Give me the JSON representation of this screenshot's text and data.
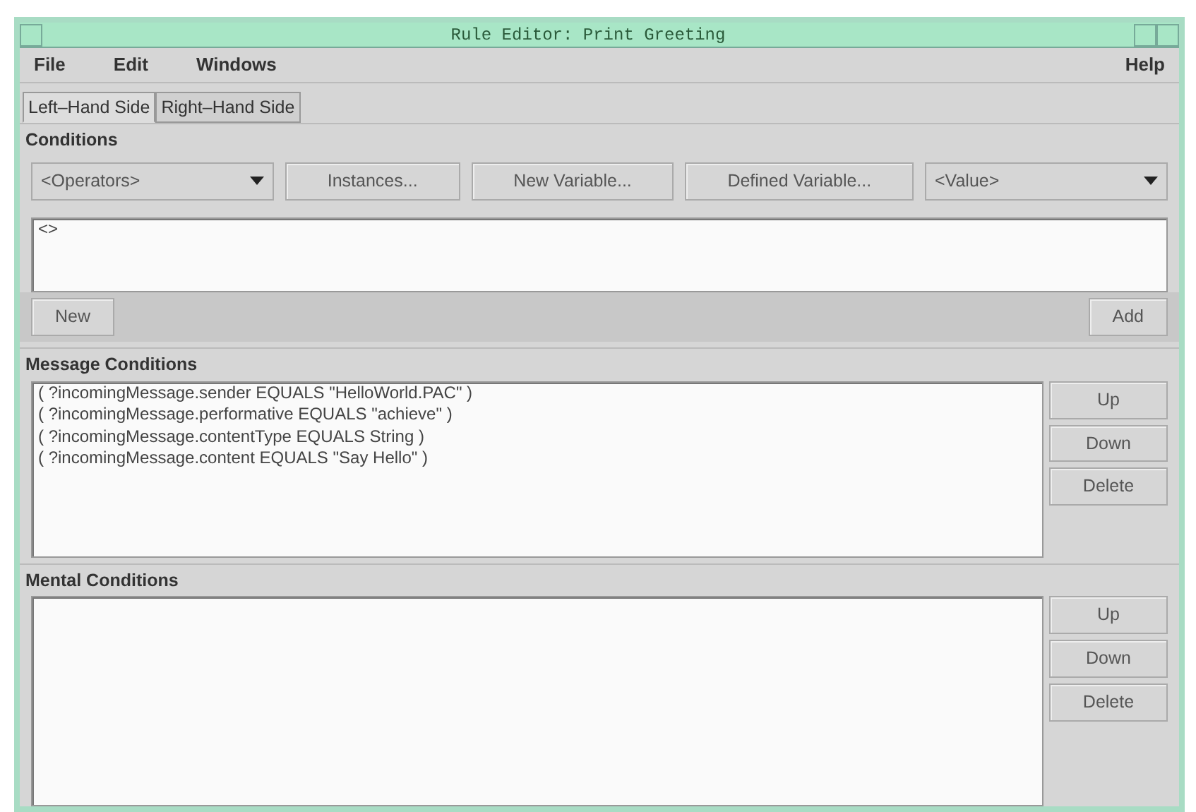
{
  "window": {
    "title": "Rule Editor: Print Greeting"
  },
  "menu": [
    {
      "label": "File"
    },
    {
      "label": "Edit"
    },
    {
      "label": "Windows"
    },
    {
      "label": "Help"
    }
  ],
  "tabs": [
    {
      "label": "Left–Hand Side",
      "selected": true
    },
    {
      "label": "Right–Hand Side",
      "selected": false
    }
  ],
  "conditions": {
    "title": "Conditions",
    "toolbar": [
      {
        "kind": "dropdown",
        "label": "<Operators>"
      },
      {
        "kind": "button",
        "label": "Instances..."
      },
      {
        "kind": "button",
        "label": "New Variable..."
      },
      {
        "kind": "button",
        "label": "Defined Variable..."
      },
      {
        "kind": "dropdown",
        "label": "<Value>"
      }
    ],
    "editor_value": "<>",
    "new_button": "New",
    "add_button": "Add"
  },
  "message_conditions": {
    "title": "Message Conditions",
    "items": [
      "( ?incomingMessage.sender EQUALS \"HelloWorld.PAC\" )",
      "( ?incomingMessage.performative EQUALS \"achieve\" )",
      "( ?incomingMessage.contentType EQUALS String )",
      "( ?incomingMessage.content EQUALS \"Say Hello\" )"
    ],
    "buttons": [
      "Up",
      "Down",
      "Delete"
    ]
  },
  "mental_conditions": {
    "title": "Mental Conditions",
    "buttons": [
      "Up",
      "Down",
      "Delete"
    ]
  }
}
